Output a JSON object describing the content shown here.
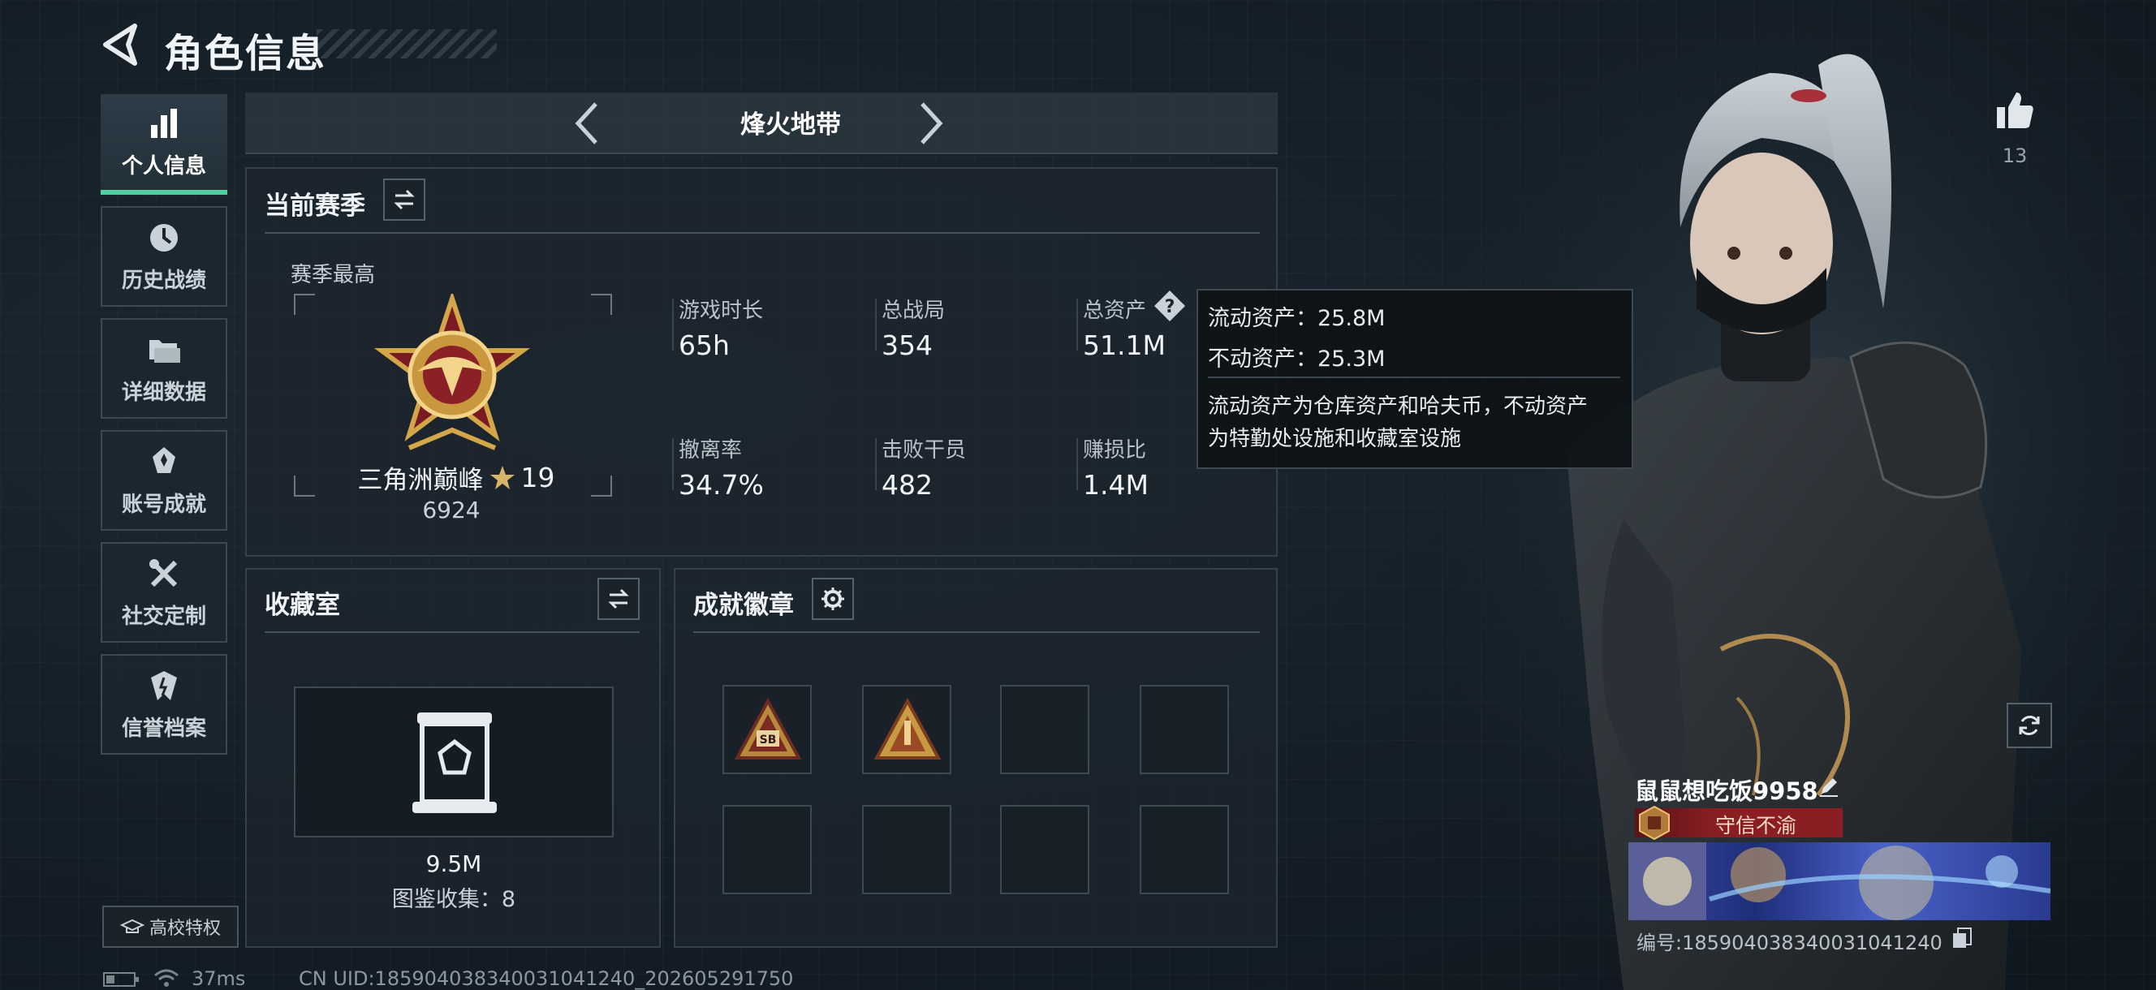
{
  "header": {
    "title": "角色信息"
  },
  "nav": {
    "items": [
      {
        "label": "个人信息",
        "icon": "bar-chart-icon",
        "active": true
      },
      {
        "label": "历史战绩",
        "icon": "clock-icon",
        "active": false
      },
      {
        "label": "详细数据",
        "icon": "folder-icon",
        "active": false
      },
      {
        "label": "账号成就",
        "icon": "medal-icon",
        "active": false
      },
      {
        "label": "社交定制",
        "icon": "tools-icon",
        "active": false
      },
      {
        "label": "信誉档案",
        "icon": "shield-icon",
        "active": false
      }
    ],
    "campus_label": "高校特权"
  },
  "mode": {
    "title": "烽火地带"
  },
  "season": {
    "title": "当前赛季",
    "best_label": "赛季最高",
    "rank_name": "三角洲巅峰",
    "rank_stars": "19",
    "rank_score": "6924",
    "stats": [
      {
        "label": "游戏时长",
        "value": "65h"
      },
      {
        "label": "总战局",
        "value": "354"
      },
      {
        "label": "总资产",
        "value": "51.1M"
      },
      {
        "label": "撤离率",
        "value": "34.7%"
      },
      {
        "label": "击败干员",
        "value": "482"
      },
      {
        "label": "赚损比",
        "value": "1.4M"
      }
    ]
  },
  "tooltip": {
    "liquid": "流动资产：25.8M",
    "fixed": "不动资产：25.3M",
    "desc_line1": "流动资产为仓库资产和哈夫币，不动资产",
    "desc_line2": "为特勤处设施和收藏室设施"
  },
  "collection": {
    "title": "收藏室",
    "value": "9.5M",
    "count": "图鉴收集：8"
  },
  "badges": {
    "title": "成就徽章",
    "slot_count": 8
  },
  "profile": {
    "likes": "13",
    "player_name": "鼠鼠想吃饭9958",
    "credit_tag": "守信不渝",
    "uid_label": "编号:185904038340031041240"
  },
  "status": {
    "ping": "37ms",
    "uid_footer": "CN UID:185904038340031041240_202605291750"
  },
  "colors": {
    "accent_green": "#4fd0a1",
    "credit_red": "#8a1e22",
    "gold": "#d4a64a"
  }
}
